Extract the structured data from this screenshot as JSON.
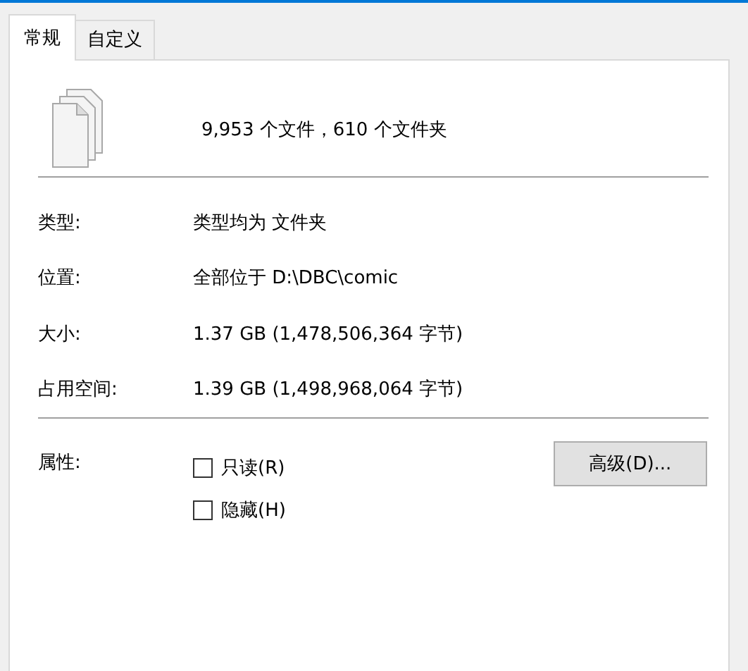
{
  "tabs": [
    {
      "label": "常规",
      "selected": true
    },
    {
      "label": "自定义",
      "selected": false
    }
  ],
  "summary": "9,953 个文件，610 个文件夹",
  "properties": [
    {
      "label": "类型:",
      "value": "类型均为 文件夹"
    },
    {
      "label": "位置:",
      "value": "全部位于 D:\\DBC\\comic"
    },
    {
      "label": "大小:",
      "value": "1.37 GB (1,478,506,364 字节)"
    },
    {
      "label": "占用空间:",
      "value": "1.39 GB (1,498,968,064 字节)"
    }
  ],
  "attributes": {
    "label": "属性:",
    "checkboxes": [
      {
        "label": "只读(R)",
        "checked": false
      },
      {
        "label": "隐藏(H)",
        "checked": false
      }
    ],
    "advanced_button": "高级(D)..."
  }
}
